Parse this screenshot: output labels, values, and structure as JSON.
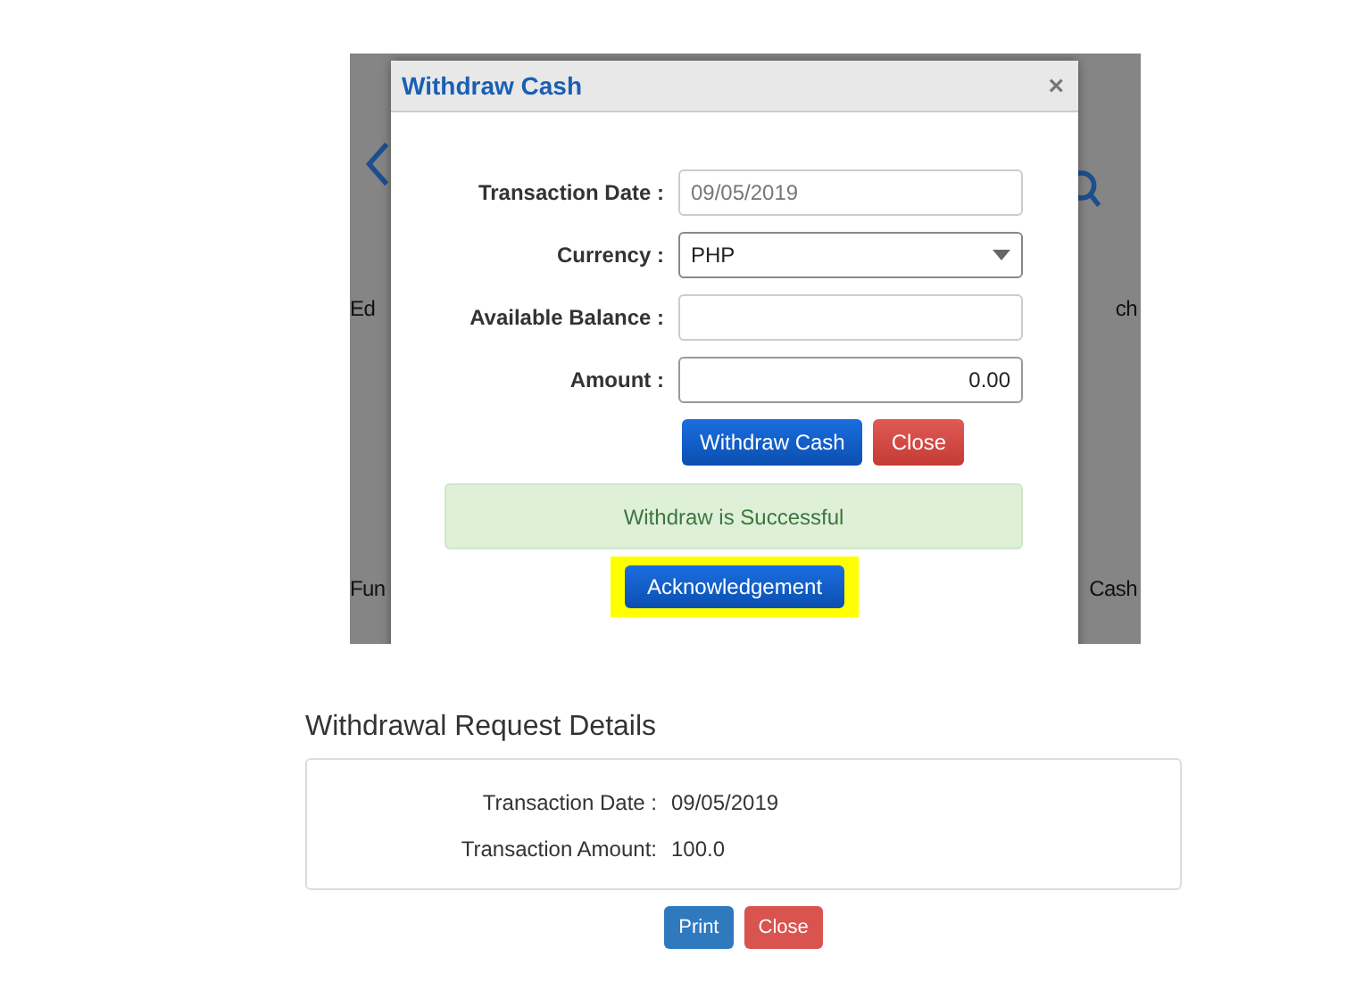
{
  "background_app": {
    "left_labels": [
      "Ed",
      "Fun"
    ],
    "right_labels": [
      "ch",
      "Cash"
    ]
  },
  "modal": {
    "title": "Withdraw Cash",
    "close": "×",
    "fields": [
      {
        "label": "Transaction Date :",
        "kind": "readonly",
        "value": "09/05/2019"
      },
      {
        "label": "Currency :",
        "kind": "select",
        "value": "PHP"
      },
      {
        "label": "Available Balance :",
        "kind": "text"
      },
      {
        "label": "Amount :",
        "kind": "number",
        "value": "0.00"
      }
    ],
    "buttons": [
      {
        "label": "Withdraw Cash",
        "kind": "primary"
      },
      {
        "label": "Close",
        "kind": "danger"
      }
    ],
    "alert": "Withdraw is Successful",
    "acknowledge": {
      "label": "Acknowledgement",
      "highlighted": true
    }
  },
  "details": {
    "title": "Withdrawal Request Details",
    "rows": [
      {
        "label": "Transaction Date :",
        "value": "09/05/2019"
      },
      {
        "label": "Transaction Amount:",
        "value": "100.0"
      }
    ],
    "buttons": [
      {
        "label": "Print",
        "kind": "primary"
      },
      {
        "label": "Close",
        "kind": "danger"
      }
    ]
  }
}
